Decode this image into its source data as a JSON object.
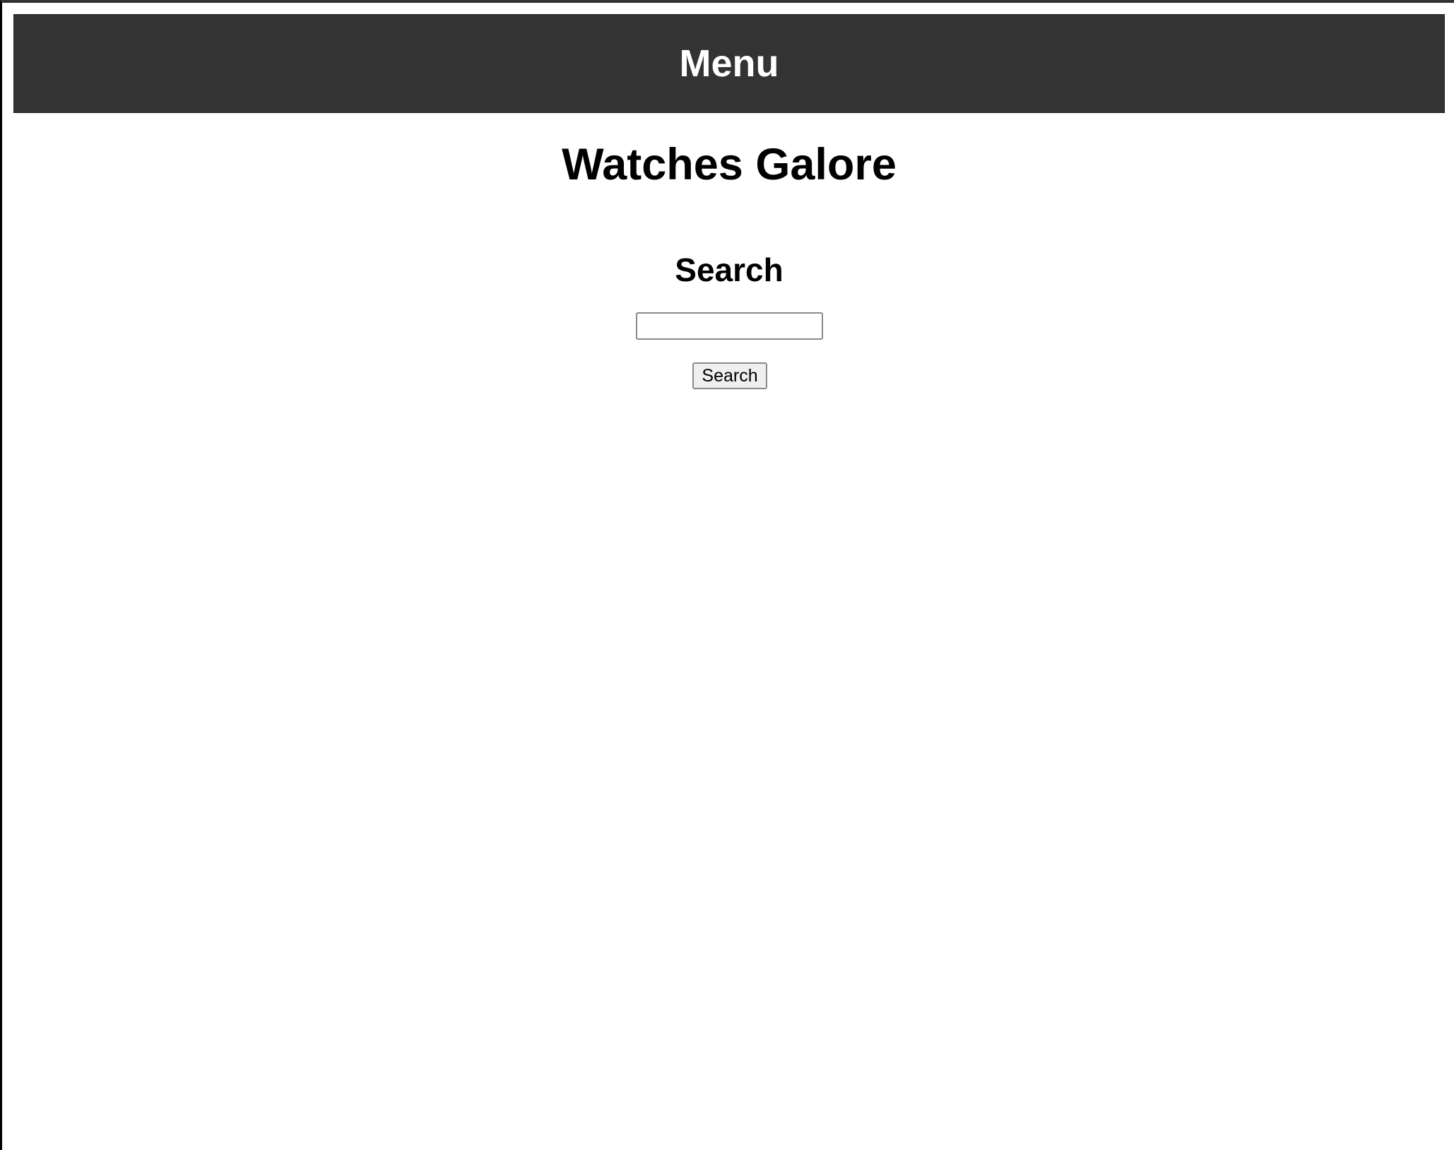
{
  "header": {
    "menu_label": "Menu"
  },
  "main": {
    "site_title": "Watches Galore",
    "search": {
      "heading": "Search",
      "input_value": "",
      "input_placeholder": "",
      "button_label": "Search"
    }
  },
  "colors": {
    "menu_background": "#333333",
    "menu_text": "#ffffff",
    "page_background": "#ffffff",
    "text": "#000000"
  }
}
